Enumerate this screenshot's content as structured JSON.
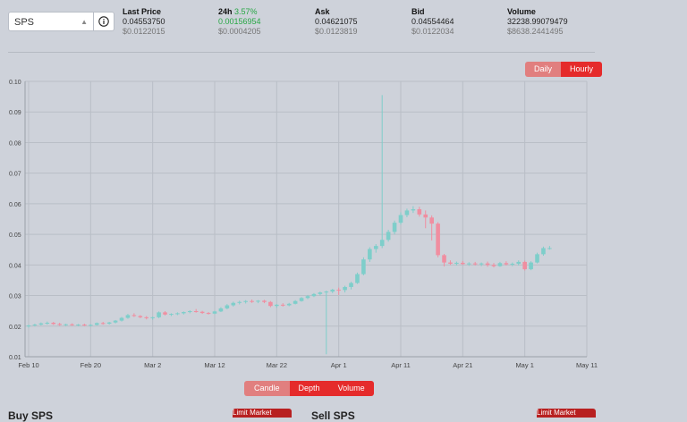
{
  "token_select": {
    "value": "SPS"
  },
  "stats": {
    "last_price": {
      "label": "Last Price",
      "value": "0.04553750",
      "usd": "$0.0122015"
    },
    "h24": {
      "label": "24h",
      "change": "3.57%",
      "value": "0.00156954",
      "usd": "$0.0004205"
    },
    "ask": {
      "label": "Ask",
      "value": "0.04621075",
      "usd": "$0.0123819"
    },
    "bid": {
      "label": "Bid",
      "value": "0.04554464",
      "usd": "$0.0122034"
    },
    "volume": {
      "label": "Volume",
      "value": "32238.99079479",
      "usd": "$8638.2441495"
    }
  },
  "interval_toggle": {
    "daily": "Daily",
    "hourly": "Hourly",
    "active": "hourly"
  },
  "chart_toggle": {
    "candle": "Candle",
    "depth": "Depth",
    "volume": "Volume",
    "active": "candle"
  },
  "bottom": {
    "buy_title": "Buy SPS",
    "sell_title": "Sell SPS",
    "buy_btn": "Limit  Market",
    "sell_btn": "Limit  Market"
  },
  "colors": {
    "up": "#7ececa",
    "down": "#f08ea0",
    "grid": "#b9bec6",
    "accent": "#e52b2b"
  },
  "chart_data": {
    "type": "candlestick",
    "title": "",
    "ylim": [
      0.01,
      0.1
    ],
    "yticks": [
      "0.01",
      "0.02",
      "0.03",
      "0.04",
      "0.05",
      "0.06",
      "0.07",
      "0.08",
      "0.09",
      "0.10"
    ],
    "xticks": [
      "Feb 10",
      "Feb 20",
      "Mar 2",
      "Mar 12",
      "Mar 22",
      "Apr 1",
      "Apr 11",
      "Apr 21",
      "May 1",
      "May 11"
    ],
    "x_range_days": [
      0,
      90
    ],
    "candles": [
      {
        "d": 0,
        "o": 0.02,
        "h": 0.0205,
        "l": 0.0195,
        "c": 0.0202
      },
      {
        "d": 1,
        "o": 0.0202,
        "h": 0.0208,
        "l": 0.0199,
        "c": 0.0205
      },
      {
        "d": 2,
        "o": 0.0205,
        "h": 0.0212,
        "l": 0.0202,
        "c": 0.0209
      },
      {
        "d": 3,
        "o": 0.0209,
        "h": 0.0215,
        "l": 0.0205,
        "c": 0.0211
      },
      {
        "d": 4,
        "o": 0.0211,
        "h": 0.0214,
        "l": 0.0204,
        "c": 0.0207
      },
      {
        "d": 5,
        "o": 0.0207,
        "h": 0.0211,
        "l": 0.0201,
        "c": 0.0204
      },
      {
        "d": 6,
        "o": 0.0204,
        "h": 0.0208,
        "l": 0.02,
        "c": 0.0206
      },
      {
        "d": 7,
        "o": 0.0206,
        "h": 0.0209,
        "l": 0.0201,
        "c": 0.0203
      },
      {
        "d": 8,
        "o": 0.0203,
        "h": 0.0207,
        "l": 0.02,
        "c": 0.0205
      },
      {
        "d": 9,
        "o": 0.0205,
        "h": 0.0208,
        "l": 0.02,
        "c": 0.0202
      },
      {
        "d": 10,
        "o": 0.0202,
        "h": 0.0206,
        "l": 0.0199,
        "c": 0.0204
      },
      {
        "d": 11,
        "o": 0.0204,
        "h": 0.0212,
        "l": 0.0202,
        "c": 0.021
      },
      {
        "d": 12,
        "o": 0.021,
        "h": 0.0214,
        "l": 0.0205,
        "c": 0.0208
      },
      {
        "d": 13,
        "o": 0.0208,
        "h": 0.0214,
        "l": 0.0205,
        "c": 0.0212
      },
      {
        "d": 14,
        "o": 0.0212,
        "h": 0.022,
        "l": 0.0209,
        "c": 0.0218
      },
      {
        "d": 15,
        "o": 0.0218,
        "h": 0.023,
        "l": 0.0215,
        "c": 0.0227
      },
      {
        "d": 16,
        "o": 0.0227,
        "h": 0.024,
        "l": 0.0224,
        "c": 0.0236
      },
      {
        "d": 17,
        "o": 0.0236,
        "h": 0.0242,
        "l": 0.023,
        "c": 0.0233
      },
      {
        "d": 18,
        "o": 0.0233,
        "h": 0.0236,
        "l": 0.0226,
        "c": 0.0229
      },
      {
        "d": 19,
        "o": 0.0229,
        "h": 0.0233,
        "l": 0.0222,
        "c": 0.0226
      },
      {
        "d": 20,
        "o": 0.0226,
        "h": 0.0231,
        "l": 0.0221,
        "c": 0.0229
      },
      {
        "d": 21,
        "o": 0.0229,
        "h": 0.0248,
        "l": 0.0226,
        "c": 0.0245
      },
      {
        "d": 22,
        "o": 0.0245,
        "h": 0.0249,
        "l": 0.0235,
        "c": 0.0238
      },
      {
        "d": 23,
        "o": 0.0238,
        "h": 0.0242,
        "l": 0.0233,
        "c": 0.024
      },
      {
        "d": 24,
        "o": 0.024,
        "h": 0.0245,
        "l": 0.0236,
        "c": 0.0242
      },
      {
        "d": 25,
        "o": 0.0242,
        "h": 0.0248,
        "l": 0.0238,
        "c": 0.0246
      },
      {
        "d": 26,
        "o": 0.0246,
        "h": 0.0252,
        "l": 0.0242,
        "c": 0.0249
      },
      {
        "d": 27,
        "o": 0.0249,
        "h": 0.0256,
        "l": 0.0244,
        "c": 0.0247
      },
      {
        "d": 28,
        "o": 0.0247,
        "h": 0.025,
        "l": 0.024,
        "c": 0.0243
      },
      {
        "d": 29,
        "o": 0.0243,
        "h": 0.0246,
        "l": 0.0238,
        "c": 0.0241
      },
      {
        "d": 30,
        "o": 0.0241,
        "h": 0.025,
        "l": 0.0239,
        "c": 0.0248
      },
      {
        "d": 31,
        "o": 0.0248,
        "h": 0.0262,
        "l": 0.0246,
        "c": 0.0258
      },
      {
        "d": 32,
        "o": 0.0258,
        "h": 0.0272,
        "l": 0.0255,
        "c": 0.0268
      },
      {
        "d": 33,
        "o": 0.0268,
        "h": 0.028,
        "l": 0.0264,
        "c": 0.0276
      },
      {
        "d": 34,
        "o": 0.0276,
        "h": 0.0283,
        "l": 0.0271,
        "c": 0.0279
      },
      {
        "d": 35,
        "o": 0.0279,
        "h": 0.0285,
        "l": 0.0274,
        "c": 0.0282
      },
      {
        "d": 36,
        "o": 0.0282,
        "h": 0.0287,
        "l": 0.0276,
        "c": 0.028
      },
      {
        "d": 37,
        "o": 0.028,
        "h": 0.0285,
        "l": 0.0275,
        "c": 0.0283
      },
      {
        "d": 38,
        "o": 0.0283,
        "h": 0.0286,
        "l": 0.0275,
        "c": 0.0279
      },
      {
        "d": 39,
        "o": 0.0279,
        "h": 0.0282,
        "l": 0.0262,
        "c": 0.0266
      },
      {
        "d": 40,
        "o": 0.0266,
        "h": 0.0272,
        "l": 0.026,
        "c": 0.027
      },
      {
        "d": 41,
        "o": 0.027,
        "h": 0.0275,
        "l": 0.0264,
        "c": 0.0268
      },
      {
        "d": 42,
        "o": 0.0268,
        "h": 0.0276,
        "l": 0.0265,
        "c": 0.0273
      },
      {
        "d": 43,
        "o": 0.0273,
        "h": 0.0285,
        "l": 0.0271,
        "c": 0.0282
      },
      {
        "d": 44,
        "o": 0.0282,
        "h": 0.0295,
        "l": 0.028,
        "c": 0.0292
      },
      {
        "d": 45,
        "o": 0.0292,
        "h": 0.0302,
        "l": 0.0288,
        "c": 0.0298
      },
      {
        "d": 46,
        "o": 0.0298,
        "h": 0.0308,
        "l": 0.0295,
        "c": 0.0305
      },
      {
        "d": 47,
        "o": 0.0305,
        "h": 0.0313,
        "l": 0.03,
        "c": 0.031
      },
      {
        "d": 48,
        "o": 0.031,
        "h": 0.0316,
        "l": 0.0108,
        "c": 0.0313
      },
      {
        "d": 49,
        "o": 0.0313,
        "h": 0.0322,
        "l": 0.0308,
        "c": 0.0319
      },
      {
        "d": 50,
        "o": 0.0319,
        "h": 0.0326,
        "l": 0.0302,
        "c": 0.0318
      },
      {
        "d": 51,
        "o": 0.0318,
        "h": 0.0332,
        "l": 0.031,
        "c": 0.0328
      },
      {
        "d": 52,
        "o": 0.0328,
        "h": 0.0345,
        "l": 0.032,
        "c": 0.0341
      },
      {
        "d": 53,
        "o": 0.0341,
        "h": 0.0375,
        "l": 0.0338,
        "c": 0.037
      },
      {
        "d": 54,
        "o": 0.037,
        "h": 0.0425,
        "l": 0.0366,
        "c": 0.0418
      },
      {
        "d": 55,
        "o": 0.0418,
        "h": 0.0458,
        "l": 0.041,
        "c": 0.0452
      },
      {
        "d": 56,
        "o": 0.0452,
        "h": 0.0468,
        "l": 0.044,
        "c": 0.0462
      },
      {
        "d": 57,
        "o": 0.0462,
        "h": 0.0955,
        "l": 0.0455,
        "c": 0.0482
      },
      {
        "d": 58,
        "o": 0.0482,
        "h": 0.0515,
        "l": 0.0476,
        "c": 0.0508
      },
      {
        "d": 59,
        "o": 0.0508,
        "h": 0.0545,
        "l": 0.05,
        "c": 0.0538
      },
      {
        "d": 60,
        "o": 0.0538,
        "h": 0.0572,
        "l": 0.0532,
        "c": 0.0563
      },
      {
        "d": 61,
        "o": 0.0563,
        "h": 0.0584,
        "l": 0.0556,
        "c": 0.0578
      },
      {
        "d": 62,
        "o": 0.0578,
        "h": 0.0592,
        "l": 0.057,
        "c": 0.0582
      },
      {
        "d": 63,
        "o": 0.0582,
        "h": 0.059,
        "l": 0.0558,
        "c": 0.0565
      },
      {
        "d": 64,
        "o": 0.0565,
        "h": 0.0578,
        "l": 0.052,
        "c": 0.0555
      },
      {
        "d": 65,
        "o": 0.0555,
        "h": 0.0562,
        "l": 0.048,
        "c": 0.0535
      },
      {
        "d": 66,
        "o": 0.0535,
        "h": 0.054,
        "l": 0.0425,
        "c": 0.0432
      },
      {
        "d": 67,
        "o": 0.0432,
        "h": 0.0436,
        "l": 0.0395,
        "c": 0.0408
      },
      {
        "d": 68,
        "o": 0.0408,
        "h": 0.0415,
        "l": 0.04,
        "c": 0.0404
      },
      {
        "d": 69,
        "o": 0.0404,
        "h": 0.0411,
        "l": 0.0398,
        "c": 0.0407
      },
      {
        "d": 70,
        "o": 0.0407,
        "h": 0.0413,
        "l": 0.04,
        "c": 0.0403
      },
      {
        "d": 71,
        "o": 0.0403,
        "h": 0.0409,
        "l": 0.0397,
        "c": 0.0405
      },
      {
        "d": 72,
        "o": 0.0405,
        "h": 0.041,
        "l": 0.0398,
        "c": 0.0402
      },
      {
        "d": 73,
        "o": 0.0402,
        "h": 0.0408,
        "l": 0.0396,
        "c": 0.0405
      },
      {
        "d": 74,
        "o": 0.0405,
        "h": 0.0411,
        "l": 0.0394,
        "c": 0.04
      },
      {
        "d": 75,
        "o": 0.04,
        "h": 0.0406,
        "l": 0.0392,
        "c": 0.0396
      },
      {
        "d": 76,
        "o": 0.0396,
        "h": 0.041,
        "l": 0.0394,
        "c": 0.0406
      },
      {
        "d": 77,
        "o": 0.0406,
        "h": 0.0412,
        "l": 0.0398,
        "c": 0.0402
      },
      {
        "d": 78,
        "o": 0.0402,
        "h": 0.0408,
        "l": 0.0396,
        "c": 0.0404
      },
      {
        "d": 79,
        "o": 0.0404,
        "h": 0.0415,
        "l": 0.0398,
        "c": 0.041
      },
      {
        "d": 80,
        "o": 0.041,
        "h": 0.0414,
        "l": 0.0382,
        "c": 0.0386
      },
      {
        "d": 81,
        "o": 0.0386,
        "h": 0.0412,
        "l": 0.0383,
        "c": 0.0408
      },
      {
        "d": 82,
        "o": 0.0408,
        "h": 0.044,
        "l": 0.0405,
        "c": 0.0435
      },
      {
        "d": 83,
        "o": 0.0435,
        "h": 0.046,
        "l": 0.043,
        "c": 0.0455
      },
      {
        "d": 84,
        "o": 0.0455,
        "h": 0.0462,
        "l": 0.045,
        "c": 0.0455
      }
    ]
  }
}
